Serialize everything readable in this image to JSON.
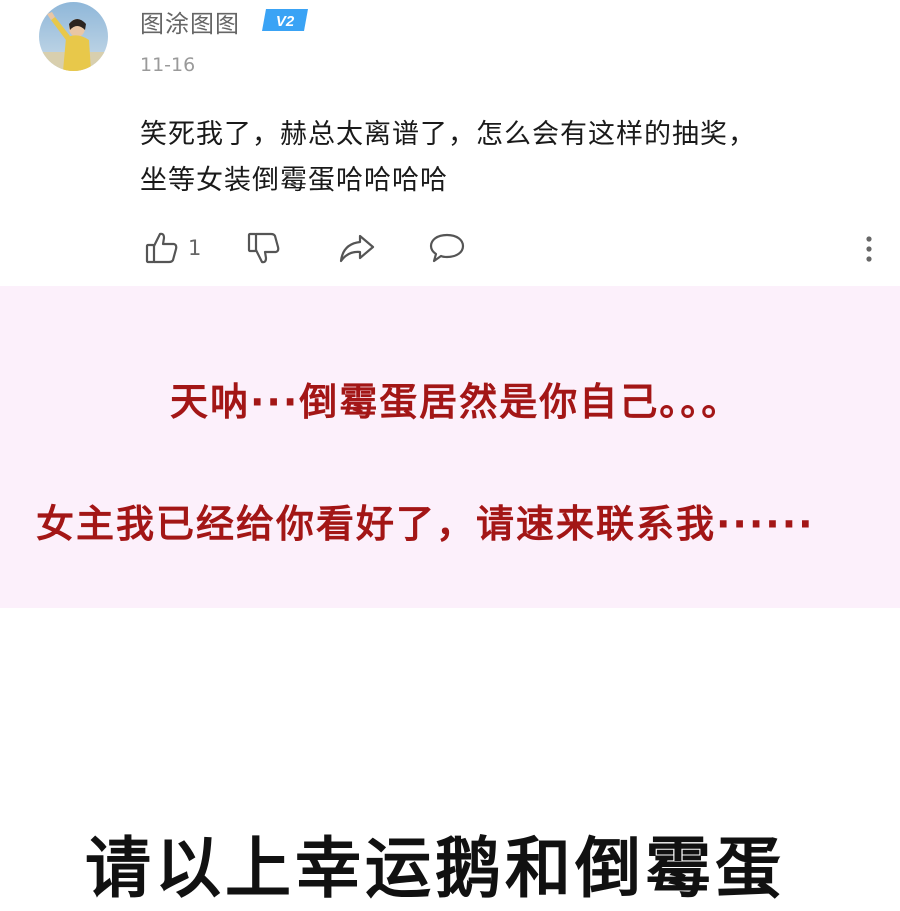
{
  "comment": {
    "username": "图涂图图",
    "badge": "V2",
    "date": "11-16",
    "text_lines": [
      "笑死我了，赫总太离谱了，怎么会有这样的抽奖，",
      "坐等女装倒霉蛋哈哈哈哈"
    ],
    "like_count": "1",
    "icons": {
      "avatar": "user-avatar",
      "like": "thumbs-up-icon",
      "dislike": "thumbs-down-icon",
      "share": "share-arrow-icon",
      "reply": "speech-bubble-icon",
      "more": "more-vertical-icon"
    }
  },
  "captions": [
    "天呐···倒霉蛋居然是你自己。。。",
    "女主我已经给你看好了，请速来联系我······"
  ],
  "bottom_title": "请以上幸运鹅和倒霉蛋",
  "colors": {
    "caption_red": "#a31616",
    "pink_band": "#fcf0fb",
    "badge_blue": "#3aa3f5"
  }
}
